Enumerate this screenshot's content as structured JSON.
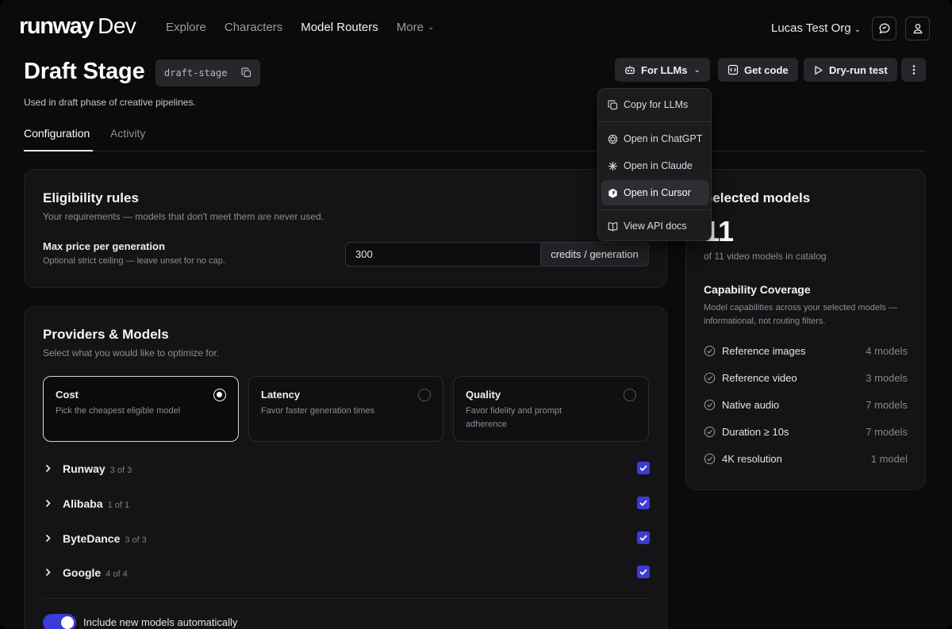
{
  "brand": {
    "logo_word": "runway",
    "logo_suffix": "Dev"
  },
  "nav": {
    "links": [
      "Explore",
      "Characters",
      "Model Routers",
      "More"
    ],
    "org": "Lucas Test Org"
  },
  "header": {
    "title": "Draft Stage",
    "slug": "draft-stage",
    "subtitle": "Used in draft phase of creative pipelines.",
    "tabs": [
      "Configuration",
      "Activity"
    ],
    "buttons": {
      "for_llms": "For LLMs",
      "get_code": "Get code",
      "dry_run": "Dry-run test"
    }
  },
  "llm_menu": {
    "items": [
      "Copy for LLMs",
      "Open in ChatGPT",
      "Open in Claude",
      "Open in Cursor",
      "View API docs"
    ]
  },
  "eligibility": {
    "title": "Eligibility rules",
    "subtitle": "Your requirements — models that don't meet them are never used.",
    "max_price_label": "Max price per generation",
    "max_price_help": "Optional strict ceiling — leave unset for no cap.",
    "max_price_value": "300",
    "max_price_unit": "credits / generation"
  },
  "providers": {
    "title": "Providers & Models",
    "subtitle": "Select what you would like to optimize for.",
    "options": [
      {
        "title": "Cost",
        "desc": "Pick the cheapest eligible model",
        "selected": true
      },
      {
        "title": "Latency",
        "desc": "Favor faster generation times",
        "selected": false
      },
      {
        "title": "Quality",
        "desc": "Favor fidelity and prompt adherence",
        "selected": false
      }
    ],
    "list": [
      {
        "name": "Runway",
        "count": "3 of 3",
        "checked": true
      },
      {
        "name": "Alibaba",
        "count": "1 of 1",
        "checked": true
      },
      {
        "name": "ByteDance",
        "count": "3 of 3",
        "checked": true
      },
      {
        "name": "Google",
        "count": "4 of 4",
        "checked": true
      }
    ],
    "auto_include_label": "Include new models automatically",
    "auto_include_on": true
  },
  "selected": {
    "title": "Selected models",
    "count": "11",
    "catalog_note": "of 11 video models in catalog",
    "coverage_title": "Capability Coverage",
    "coverage_desc": "Model capabilities across your selected models — informational, not routing filters.",
    "capabilities": [
      {
        "name": "Reference images",
        "count": "4 models"
      },
      {
        "name": "Reference video",
        "count": "3 models"
      },
      {
        "name": "Native audio",
        "count": "7 models"
      },
      {
        "name": "Duration ≥ 10s",
        "count": "7 models"
      },
      {
        "name": "4K resolution",
        "count": "1 model"
      }
    ]
  },
  "colors": {
    "accent": "#3b3bd8",
    "background": "#0b0b0c",
    "card": "#141416"
  }
}
